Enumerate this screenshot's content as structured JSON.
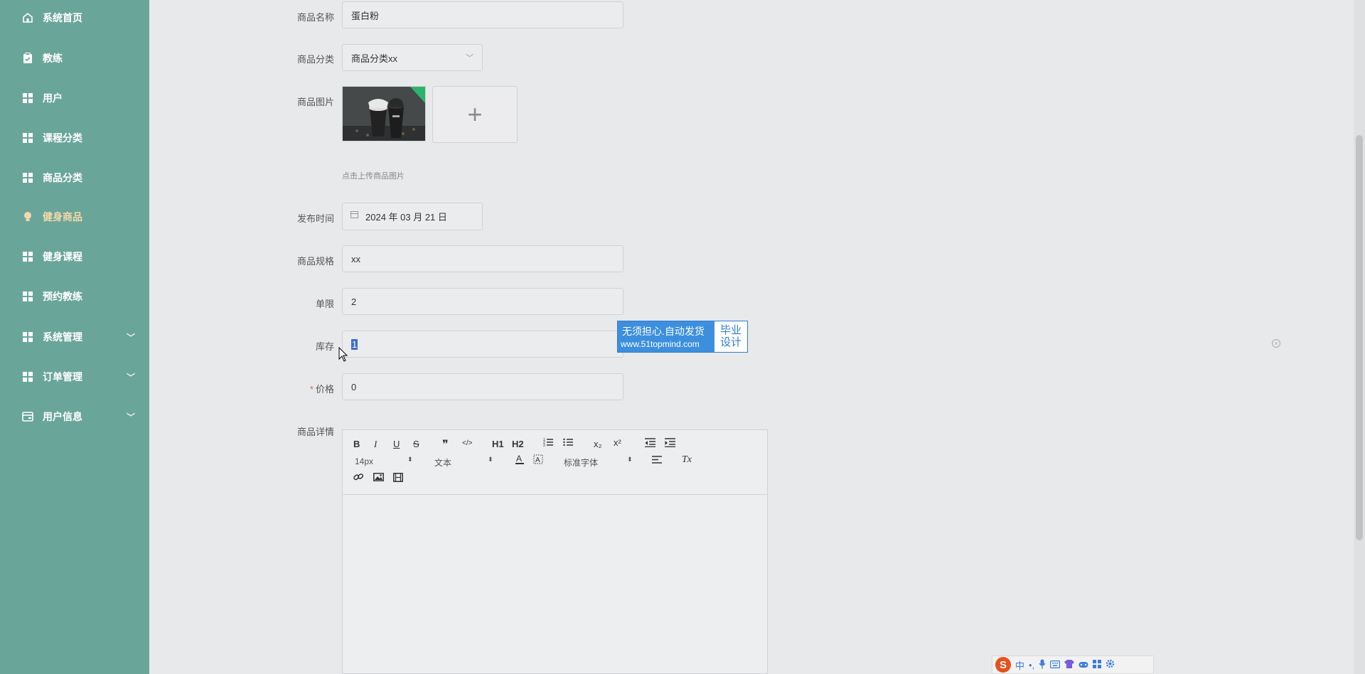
{
  "sidebar": {
    "items": [
      {
        "label": "系统首页",
        "icon": "home-icon"
      },
      {
        "label": "教练",
        "icon": "clipboard-icon"
      },
      {
        "label": "用户",
        "icon": "grid-icon"
      },
      {
        "label": "课程分类",
        "icon": "grid-icon"
      },
      {
        "label": "商品分类",
        "icon": "grid-icon"
      },
      {
        "label": "健身商品",
        "icon": "bulb-icon",
        "active": true
      },
      {
        "label": "健身课程",
        "icon": "grid-icon"
      },
      {
        "label": "预约教练",
        "icon": "grid-icon"
      },
      {
        "label": "系统管理",
        "icon": "grid-icon",
        "expandable": true
      },
      {
        "label": "订单管理",
        "icon": "grid-icon",
        "expandable": true
      },
      {
        "label": "用户信息",
        "icon": "card-icon",
        "expandable": true
      }
    ],
    "active_color": "#f4d9a7",
    "bg_color": "#6aa59a"
  },
  "form": {
    "name_label": "商品名称",
    "name_value": "蛋白粉",
    "category_label": "商品分类",
    "category_value": "商品分类xx",
    "image_label": "商品图片",
    "upload_plus": "+",
    "upload_hint": "点击上传商品图片",
    "date_label": "发布时间",
    "date_value": "2024 年 03 月 21 日",
    "spec_label": "商品规格",
    "spec_value": "xx",
    "limit_label": "单限",
    "limit_value": "2",
    "stock_label": "库存",
    "stock_value": "1",
    "price_required": "*",
    "price_label": "价格",
    "price_value": "0",
    "detail_label": "商品详情"
  },
  "editor": {
    "bold": "B",
    "italic": "I",
    "underline": "U",
    "strike": "S",
    "quote": "❞",
    "code": "</>",
    "h1": "H1",
    "h2": "H2",
    "sub": "x₂",
    "sup": "x²",
    "font_size": "14px",
    "text_style": "文本",
    "font_family": "标准字体",
    "clear_format": "Tx"
  },
  "watermark": {
    "line1": "无须担心.自动发货",
    "line2": "www.51topmind.com",
    "right1": "毕业",
    "right2": "设计"
  },
  "ime": {
    "logo": "S",
    "mode": "中",
    "punct": "•,"
  }
}
